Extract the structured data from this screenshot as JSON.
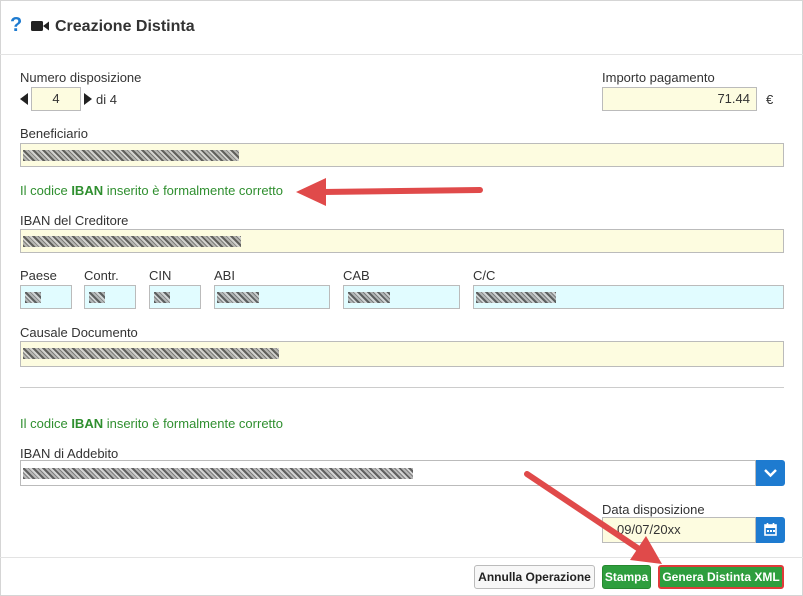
{
  "header": {
    "title": "Creazione Distinta",
    "help_icon": "question-icon",
    "video_icon": "video-camera-icon"
  },
  "numero": {
    "label": "Numero disposizione",
    "value": "4",
    "total": "di 4"
  },
  "importo": {
    "label": "Importo pagamento",
    "value": "71.44",
    "currency": "€"
  },
  "beneficiario": {
    "label": "Beneficiario"
  },
  "iban_msg_1": {
    "pre": "Il codice ",
    "bold": "IBAN",
    "post": " inserito è formalmente corretto"
  },
  "iban_creditore": {
    "label": "IBAN del Creditore"
  },
  "parts": {
    "paese": "Paese",
    "contr": "Contr.",
    "cin": "CIN",
    "abi": "ABI",
    "cab": "CAB",
    "cc": "C/C"
  },
  "causale": {
    "label": "Causale Documento"
  },
  "iban_msg_2": {
    "pre": "Il codice ",
    "bold": "IBAN",
    "post": " inserito è formalmente corretto"
  },
  "iban_addebito": {
    "label": "IBAN di Addebito"
  },
  "data_disposizione": {
    "label": "Data disposizione",
    "value": "09/07/20xx"
  },
  "buttons": {
    "annulla": "Annulla Operazione",
    "stampa": "Stampa",
    "genera": "Genera Distinta XML"
  },
  "colors": {
    "accent": "#1e7bd0",
    "ok": "#2f8f2f",
    "arrow": "#e04a4a",
    "field_yellow": "#fdfce0",
    "field_blue": "#e1fcff"
  }
}
